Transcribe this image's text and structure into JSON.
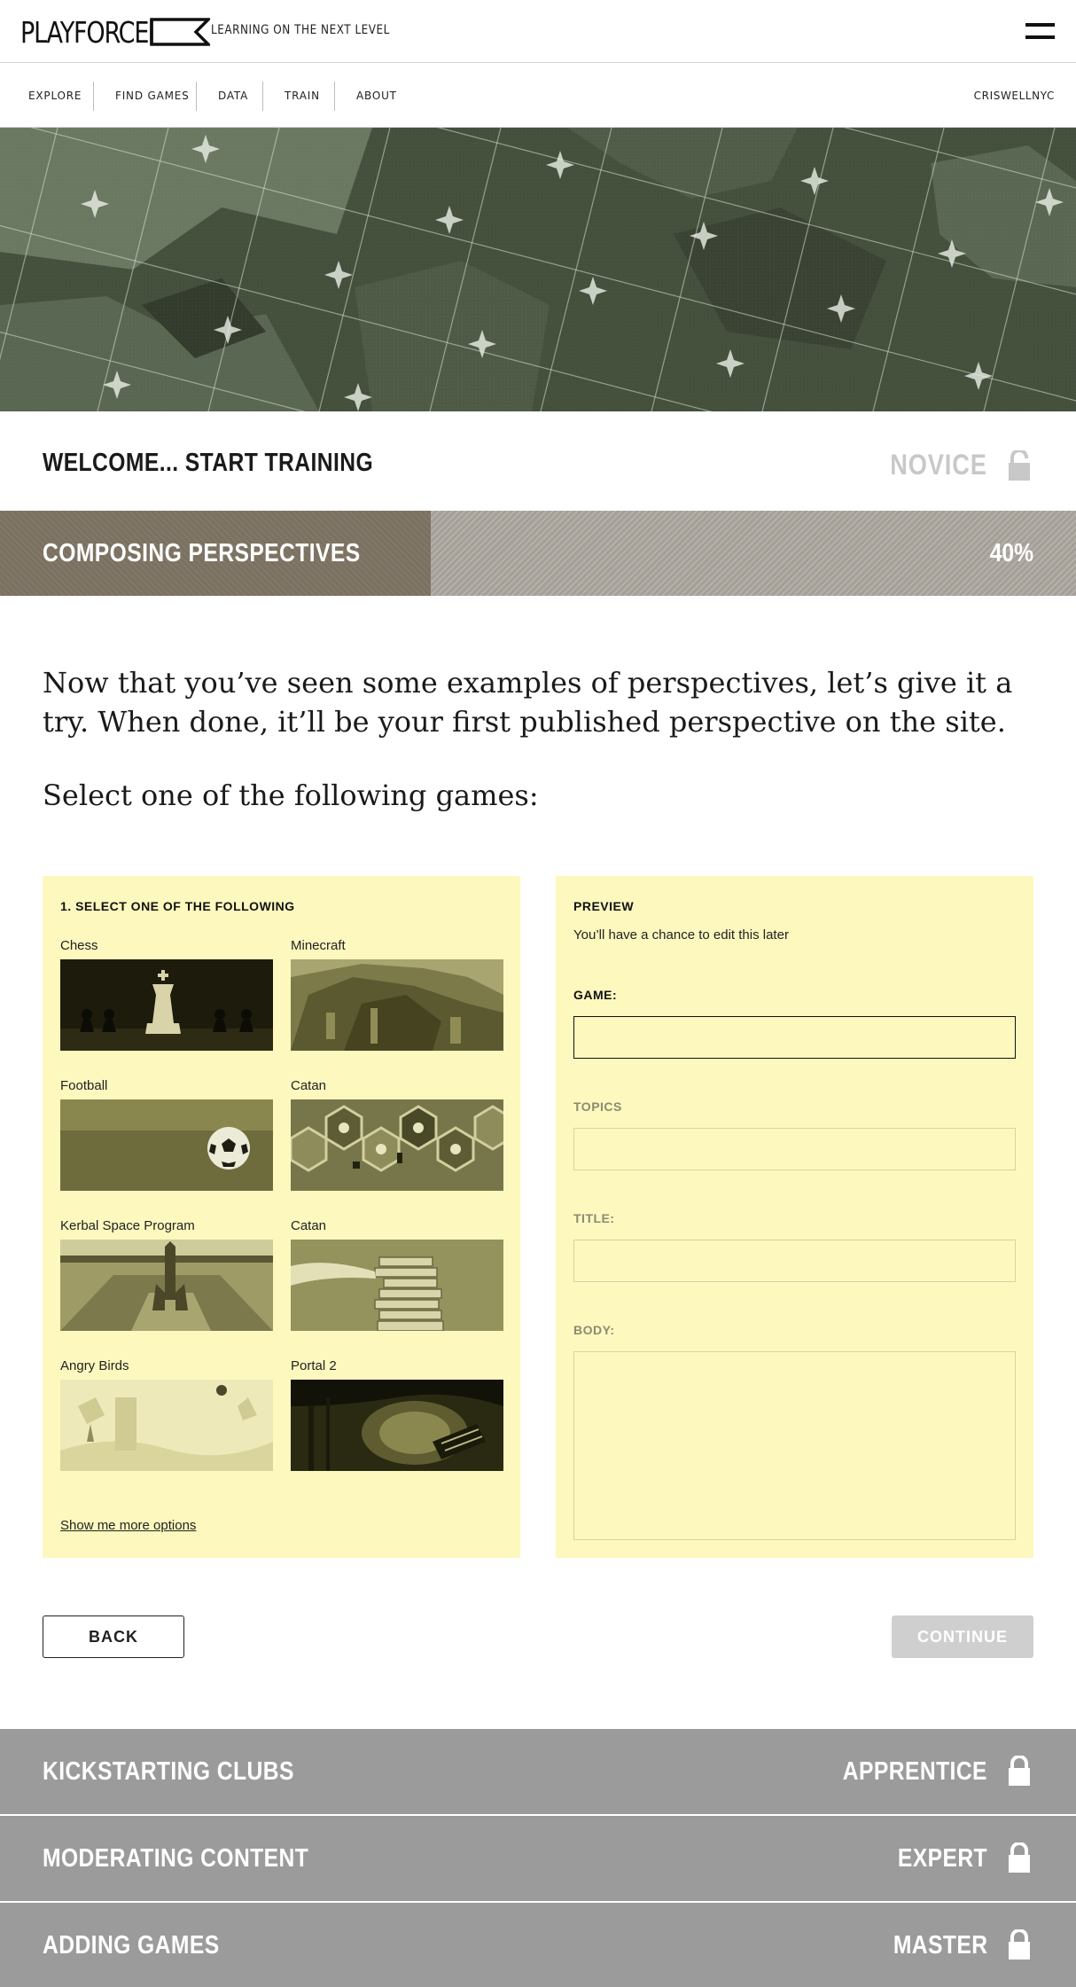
{
  "header": {
    "logo_text": "PLAYFORCE",
    "tagline": "LEARNING ON THE NEXT LEVEL",
    "menu_icon": "hamburger-menu-icon"
  },
  "nav": {
    "items": [
      {
        "label": "EXPLORE"
      },
      {
        "label": "FIND GAMES"
      },
      {
        "label": "DATA"
      },
      {
        "label": "TRAIN"
      },
      {
        "label": "ABOUT"
      }
    ],
    "user": "CRISWELLNYC"
  },
  "welcome": {
    "title": "WELCOME... START TRAINING",
    "level": "NOVICE",
    "lock_icon": "unlocked-padlock-icon"
  },
  "current_module": {
    "title": "COMPOSING PERSPECTIVES",
    "progress_label": "40%",
    "progress": 0.4
  },
  "intro": {
    "text": "Now that you’ve seen some examples of perspectives, let’s give it a try. When done, it’ll be your first published perspective on the site.",
    "select_heading": "Select one of the following games:"
  },
  "selector": {
    "heading": "1. SELECT ONE OF THE FOLLOWING",
    "games": [
      {
        "name": "Chess"
      },
      {
        "name": "Minecraft"
      },
      {
        "name": "Football"
      },
      {
        "name": "Catan"
      },
      {
        "name": "Kerbal Space Program"
      },
      {
        "name": "Catan"
      },
      {
        "name": "Angry Birds"
      },
      {
        "name": "Portal 2"
      }
    ],
    "more_link": "Show me more options"
  },
  "preview": {
    "heading": "PREVIEW",
    "subtext": "You’ll have a chance to edit this later",
    "fields": {
      "game": {
        "label": "GAME:",
        "value": ""
      },
      "topics": {
        "label": "TOPICS",
        "value": ""
      },
      "title": {
        "label": "TITLE:",
        "value": ""
      },
      "body": {
        "label": "BODY:",
        "value": ""
      }
    }
  },
  "buttons": {
    "back": "BACK",
    "continue": "CONTINUE"
  },
  "locked_modules": [
    {
      "title": "KICKSTARTING CLUBS",
      "level": "APPRENTICE"
    },
    {
      "title": "MODERATING CONTENT",
      "level": "EXPERT"
    },
    {
      "title": "ADDING GAMES",
      "level": "MASTER"
    }
  ],
  "colors": {
    "panel_bg": "#fdf8be",
    "progress_fill": "#7b7161",
    "progress_track": "#a49f97",
    "locked_module_bg": "#9b9b9b",
    "disabled_button": "#cfcfcf"
  }
}
